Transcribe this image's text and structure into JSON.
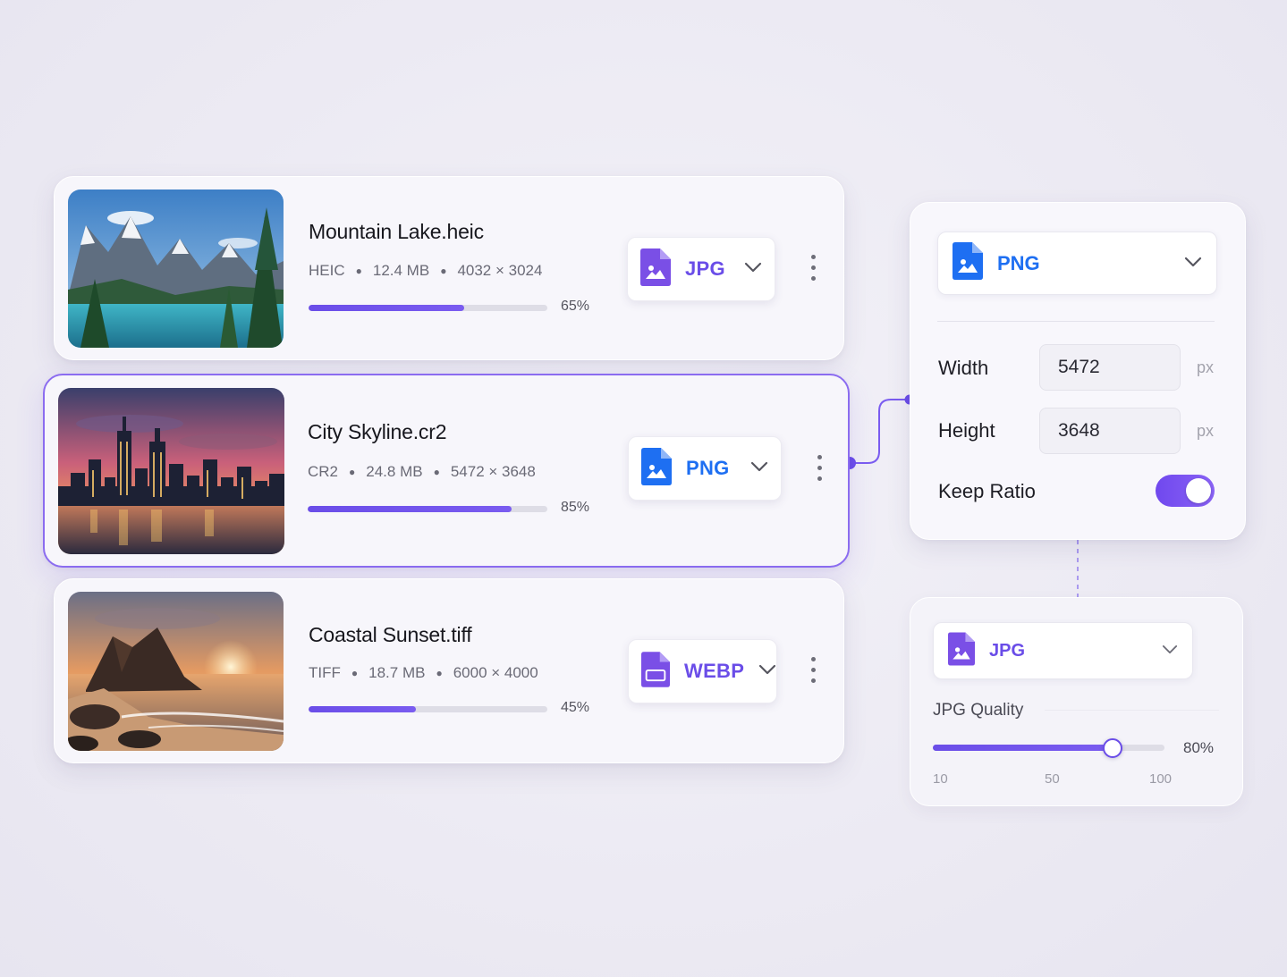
{
  "files": [
    {
      "name": "Mountain Lake.heic",
      "format": "HEIC",
      "size": "12.4 MB",
      "dimensions": "4032 × 3024",
      "progress": 65,
      "progress_label": "65%",
      "output_format": "JPG",
      "selected": false
    },
    {
      "name": "City Skyline.cr2",
      "format": "CR2",
      "size": "24.8 MB",
      "dimensions": "5472 × 3648",
      "progress": 85,
      "progress_label": "85%",
      "output_format": "PNG",
      "selected": true
    },
    {
      "name": "Coastal Sunset.tiff",
      "format": "TIFF",
      "size": "18.7 MB",
      "dimensions": "6000 × 4000",
      "progress": 45,
      "progress_label": "45%",
      "output_format": "WEBP",
      "selected": false
    }
  ],
  "resize_panel": {
    "format": "PNG",
    "width_label": "Width",
    "width_value": "5472",
    "height_label": "Height",
    "height_value": "3648",
    "unit": "px",
    "keep_ratio_label": "Keep Ratio",
    "keep_ratio": true
  },
  "quality_panel": {
    "format": "JPG",
    "quality_label": "JPG Quality",
    "quality_value": 80,
    "quality_value_label": "80%",
    "ticks": [
      "10",
      "50",
      "100"
    ]
  },
  "colors": {
    "accent": "#6a4de8",
    "jpg_icon": "#7a4fe6",
    "png_icon": "#1e6ff2",
    "png_text": "#1e6ff2",
    "webp_icon": "#7a4fe6",
    "format_text": "#6a4de8"
  },
  "icons": {
    "file_image": "file-image-icon",
    "chevron": "chevron-down-icon",
    "menu": "kebab-menu-icon"
  }
}
